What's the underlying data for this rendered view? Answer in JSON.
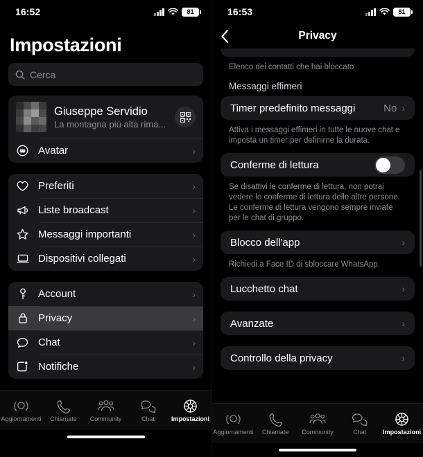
{
  "left": {
    "statusbar": {
      "time": "16:52",
      "battery": "81"
    },
    "title": "Impostazioni",
    "search": {
      "placeholder": "Cerca"
    },
    "profile": {
      "name": "Giuseppe Servidio",
      "status": "La montagna più alta rima...",
      "qr_label": "qr-code"
    },
    "avatar_row": {
      "label": "Avatar"
    },
    "group1": [
      {
        "label": "Preferiti",
        "icon": "heart-icon"
      },
      {
        "label": "Liste broadcast",
        "icon": "megaphone-icon"
      },
      {
        "label": "Messaggi importanti",
        "icon": "star-icon"
      },
      {
        "label": "Dispositivi collegati",
        "icon": "laptop-icon"
      }
    ],
    "group2": [
      {
        "label": "Account",
        "icon": "key-icon",
        "selected": false
      },
      {
        "label": "Privacy",
        "icon": "lock-icon",
        "selected": true
      },
      {
        "label": "Chat",
        "icon": "chat-bubble-icon",
        "selected": false
      },
      {
        "label": "Notifiche",
        "icon": "notification-icon",
        "selected": false
      }
    ]
  },
  "right": {
    "statusbar": {
      "time": "16:53",
      "battery": "81"
    },
    "nav": {
      "title": "Privacy",
      "back": "back-chevron"
    },
    "blocked_note": "Elenco dei contatti che hai bloccato",
    "section_ephemeral": {
      "header": "Messaggi effimeri",
      "row_label": "Timer predefinito messaggi",
      "row_value": "No",
      "note": "Attiva i messaggi effimeri in tutte le nuove chat e imposta un timer per definirne la durata."
    },
    "read_receipts": {
      "label": "Conferme di lettura",
      "toggle_on": false,
      "note": "Se disattivi le conferme di lettura, non potrai vedere le conferme di lettura delle altre persone. Le conferme di lettura vengono sempre inviate per le chat di gruppo."
    },
    "app_lock": {
      "label": "Blocco dell'app",
      "note": "Richiedi a Face ID di sbloccare WhatsApp."
    },
    "chat_lock": {
      "label": "Lucchetto chat"
    },
    "advanced": {
      "label": "Avanzate"
    },
    "privacy_checkup": {
      "label": "Controllo della privacy"
    }
  },
  "tabbar": [
    {
      "label": "Aggiornamenti",
      "icon": "updates-icon",
      "active": false
    },
    {
      "label": "Chiamate",
      "icon": "phone-icon",
      "active": false
    },
    {
      "label": "Community",
      "icon": "community-icon",
      "active": false
    },
    {
      "label": "Chat",
      "icon": "chats-icon",
      "active": false
    },
    {
      "label": "Impostazioni",
      "icon": "gear-icon",
      "active": true
    }
  ],
  "colors": {
    "background": "#000000",
    "card": "#1a1a1c",
    "selected_row": "#3a3a3c",
    "secondary_text": "#8d8d93"
  }
}
